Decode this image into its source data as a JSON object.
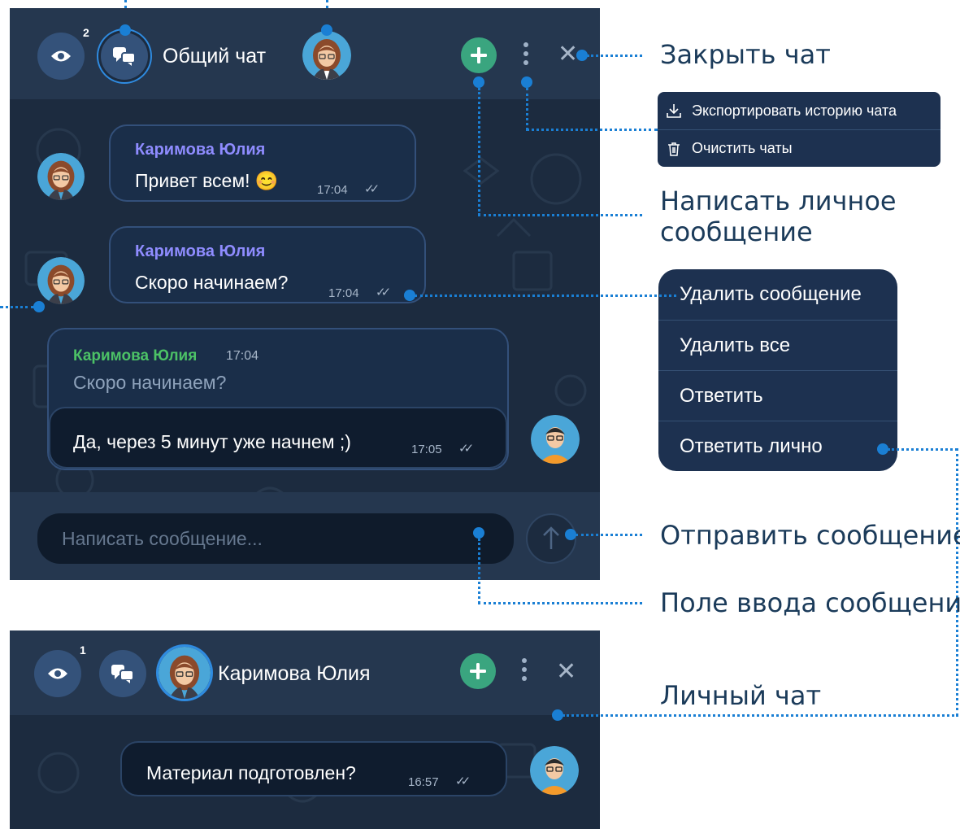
{
  "main_chat": {
    "viewers_count": "2",
    "title": "Общий чат",
    "messages": [
      {
        "author": "Каримова Юлия",
        "text": "Привет всем! 😊",
        "time": "17:04"
      },
      {
        "author": "Каримова Юлия",
        "text": "Скоро начинаем?",
        "time": "17:04"
      }
    ],
    "reply": {
      "quote_author": "Каримова Юлия",
      "quote_time": "17:04",
      "quote_text": "Скоро начинаем?",
      "text": "Да, через 5 минут уже начнем ;)",
      "time": "17:05"
    },
    "input_placeholder": "Написать сообщение..."
  },
  "chat_menu": {
    "items": [
      {
        "label": "Экспортировать историю чата",
        "icon": "download-icon"
      },
      {
        "label": "Очистить чаты",
        "icon": "trash-icon"
      }
    ]
  },
  "message_menu": {
    "items": [
      "Удалить сообщение",
      "Удалить все",
      "Ответить",
      "Ответить лично"
    ]
  },
  "private_chat": {
    "viewers_count": "1",
    "title": "Каримова Юлия",
    "message": {
      "text": "Материал подготовлен?",
      "time": "16:57"
    }
  },
  "callouts": {
    "close_chat": "Закрыть чат",
    "private_message_line1": "Написать личное",
    "private_message_line2": "сообщение",
    "send_message": "Отправить сообщение",
    "input_field": "Поле ввода сообщения",
    "private_chat": "Личный чат"
  },
  "colors": {
    "panel": "#1c2b3f",
    "header": "#25374f",
    "accent_green": "#3aa57f",
    "author_purple": "#8f8cff",
    "quote_green": "#4cc266",
    "callout_line": "#1a7fd4"
  }
}
